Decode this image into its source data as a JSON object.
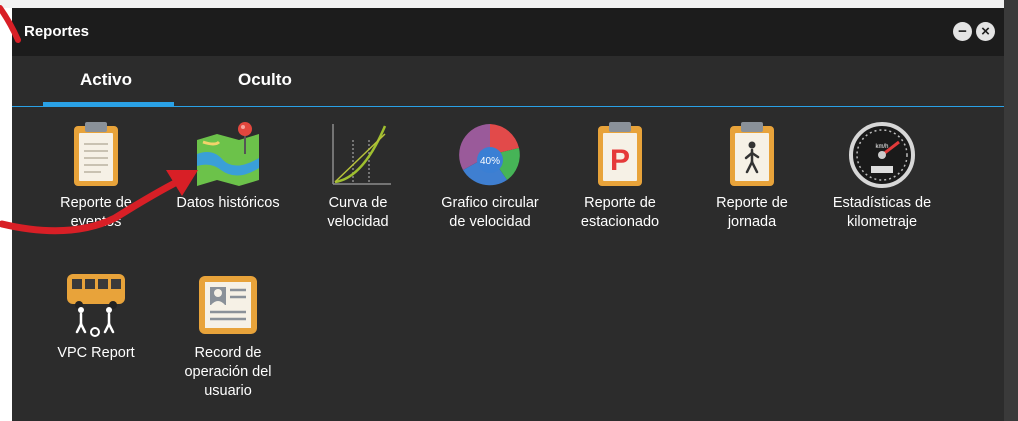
{
  "window": {
    "title": "Reportes",
    "minimize_icon": "minus-circle-icon",
    "close_icon": "x-circle-icon"
  },
  "tabs": [
    {
      "label": "Activo",
      "active": true
    },
    {
      "label": "Oculto",
      "active": false
    }
  ],
  "items": [
    {
      "label": "Reporte de\neventos",
      "icon": "clipboard-icon"
    },
    {
      "label": "Datos históricos",
      "icon": "map-pin-icon"
    },
    {
      "label": "Curva de\nvelocidad",
      "icon": "speed-curve-chart-icon"
    },
    {
      "label": "Grafico circular\nde velocidad",
      "icon": "pie-chart-icon",
      "icon_text": "40%"
    },
    {
      "label": "Reporte de\nestacionado",
      "icon": "parking-clipboard-icon",
      "icon_text": "P"
    },
    {
      "label": "Reporte de\njornada",
      "icon": "walking-clipboard-icon"
    },
    {
      "label": "Estadísticas de\nkilometraje",
      "icon": "speedometer-icon",
      "icon_text": "km/h"
    },
    {
      "label": "VPC Report",
      "icon": "bus-passengers-icon"
    },
    {
      "label": "Record de\noperación del\nusuario",
      "icon": "user-record-icon"
    }
  ],
  "colors": {
    "titlebar": "#1c1c1c",
    "panel": "#2c2c2c",
    "accent": "#2aa1e6",
    "annotation_arrow": "#d81f26"
  }
}
